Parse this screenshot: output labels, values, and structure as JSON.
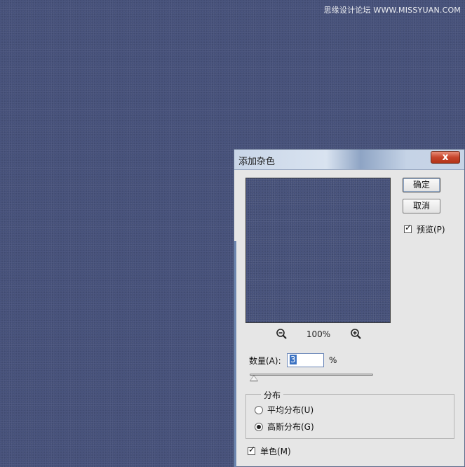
{
  "watermark": "思缘设计论坛 WWW.MISSYUAN.COM",
  "dialog": {
    "title": "添加杂色",
    "close_label": "x",
    "ok_label": "确定",
    "cancel_label": "取消",
    "preview_label": "预览(P)",
    "preview_checked": true,
    "zoom_level": "100%",
    "amount_label": "数量(A):",
    "amount_value": "3",
    "amount_unit": "%",
    "distribution_title": "分布",
    "distribution_options": [
      "平均分布(U)",
      "高斯分布(G)"
    ],
    "distribution_selected": "高斯分布(G)",
    "monochromatic_label": "单色(M)",
    "monochromatic_checked": true
  },
  "icons": [
    "zoom-out-icon",
    "zoom-in-icon",
    "close-icon"
  ],
  "colors": {
    "canvas": "#46517a",
    "dialog_bg": "#e6e6e6",
    "close_button": "#c7452c"
  }
}
